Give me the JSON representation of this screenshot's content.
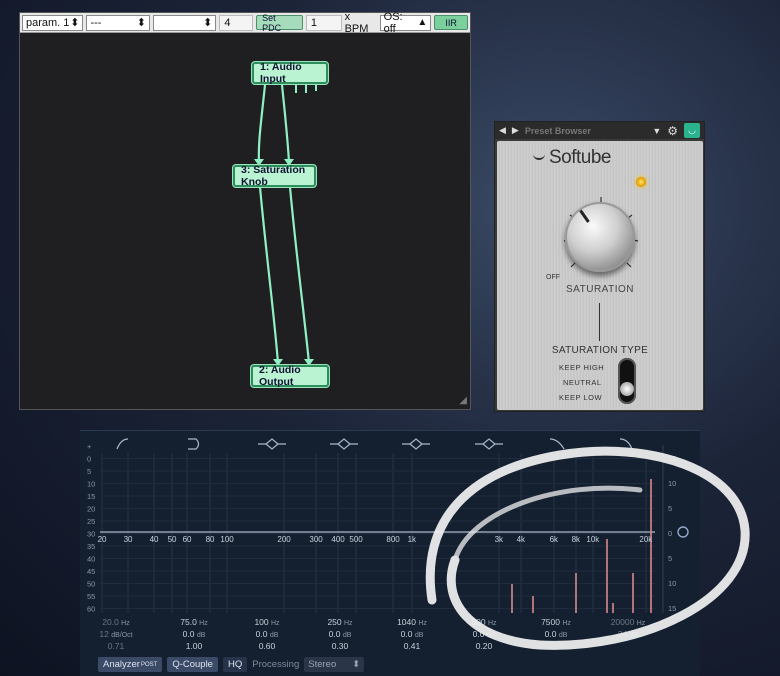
{
  "patcher": {
    "toolbar": {
      "param_select": "param. 1",
      "second_select": "---",
      "third_select": "",
      "value": "4",
      "set_pdc_label": "Set PDC",
      "bpm_value": "1",
      "bpm_label": "x BPM",
      "os_select": "OS: off",
      "iir_label": "IIR"
    },
    "nodes": {
      "audio_input": "1: Audio Input",
      "saturation_knob": "3: Saturation Knob",
      "audio_output": "2: Audio Output"
    },
    "wire_color": "#8ff0c3"
  },
  "plugin": {
    "preset_label": "Preset Browser",
    "brand": "Softube",
    "off_label": "OFF",
    "saturation_label": "SATURATION",
    "type_label": "SATURATION TYPE",
    "options": [
      "KEEP HIGH",
      "NEUTRAL",
      "KEEP LOW"
    ]
  },
  "eq": {
    "db_ticks_left": [
      "+",
      "0",
      "5",
      "10",
      "15",
      "20",
      "25",
      "30",
      "35",
      "40",
      "45",
      "50",
      "55",
      "60"
    ],
    "db_ticks_right": [
      "15",
      "10",
      "5",
      "0",
      "5",
      "10",
      "15"
    ],
    "freq_ticks": [
      "20",
      "30",
      "40",
      "50",
      "60",
      "80",
      "100",
      "200",
      "300",
      "400",
      "500",
      "800",
      "1k",
      "3k",
      "4k",
      "6k",
      "8k",
      "10k",
      "20k"
    ],
    "bands": [
      {
        "freq": "20.0",
        "freq_unit": "Hz",
        "gain": "12",
        "gain_unit": "dB/Oct",
        "q": "0.71",
        "dim": true
      },
      {
        "freq": "75.0",
        "freq_unit": "Hz",
        "gain": "0.0",
        "gain_unit": "dB",
        "q": "1.00",
        "dim": false
      },
      {
        "freq": "100",
        "freq_unit": "Hz",
        "gain": "0.0",
        "gain_unit": "dB",
        "q": "0.60",
        "dim": false
      },
      {
        "freq": "250",
        "freq_unit": "Hz",
        "gain": "0.0",
        "gain_unit": "dB",
        "q": "0.30",
        "dim": false
      },
      {
        "freq": "1040",
        "freq_unit": "Hz",
        "gain": "0.0",
        "gain_unit": "dB",
        "q": "0.41",
        "dim": false
      },
      {
        "freq": "300",
        "freq_unit": "Hz",
        "gain": "0.0",
        "gain_unit": "dB",
        "q": "0.20",
        "dim": false
      },
      {
        "freq": "7500",
        "freq_unit": "Hz",
        "gain": "0.0",
        "gain_unit": "dB",
        "q": "",
        "dim": false
      },
      {
        "freq": "20000",
        "freq_unit": "Hz",
        "gain": "24",
        "gain_unit": "",
        "q": "",
        "dim": true
      }
    ],
    "extra_right_unit": "dB",
    "footer": {
      "analyzer_label": "Analyzer",
      "analyzer_sup": "POST",
      "qcouple_label": "Q-Couple",
      "hq_label": "HQ",
      "processing_label": "Processing",
      "processing_value": "Stereo"
    },
    "curve_color": "#a9b8cc",
    "spectrum_color": "#d98a8a"
  },
  "annotation_color": "#f2f2f2"
}
